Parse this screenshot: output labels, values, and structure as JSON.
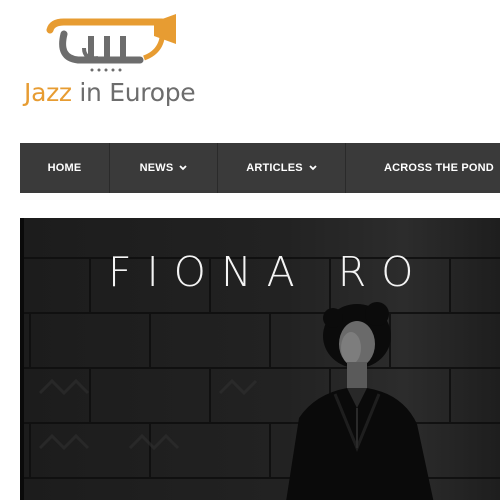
{
  "logo": {
    "word1": "Jazz",
    "word2": " in Europe",
    "icon": "trumpet-icon",
    "colors": {
      "orange": "#e79c32",
      "gray": "#6d6d6d"
    }
  },
  "nav": {
    "items": [
      {
        "label": "HOME",
        "dropdown": false
      },
      {
        "label": "NEWS",
        "dropdown": true
      },
      {
        "label": "ARTICLES",
        "dropdown": true
      },
      {
        "label": "ACROSS THE POND",
        "dropdown": false
      }
    ],
    "colors": {
      "bar": "#3a3a3a",
      "text": "#ffffff"
    }
  },
  "hero": {
    "title": "FIONA RO"
  }
}
